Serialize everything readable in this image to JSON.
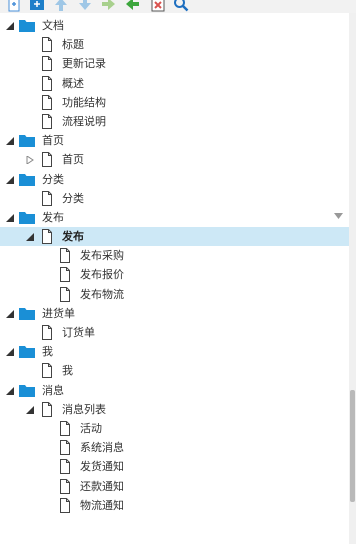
{
  "toolbar": {
    "buttons": [
      {
        "name": "new-file-icon",
        "color": "#4a90d9"
      },
      {
        "name": "new-folder-icon",
        "color": "#1e7fc9"
      },
      {
        "name": "move-up-icon",
        "color": "#9fc7e6"
      },
      {
        "name": "move-down-icon",
        "color": "#9fc7e6"
      },
      {
        "name": "indent-icon",
        "color": "#a8d08d"
      },
      {
        "name": "outdent-icon",
        "color": "#3ca63c"
      },
      {
        "name": "delete-icon",
        "color": "#d9534f"
      },
      {
        "name": "search-icon",
        "color": "#1e6fc0"
      }
    ]
  },
  "tree": {
    "nodes": [
      {
        "label": "文档",
        "type": "folder",
        "level": 0,
        "expander": "expanded"
      },
      {
        "label": "标题",
        "type": "file",
        "level": 1
      },
      {
        "label": "更新记录",
        "type": "file",
        "level": 1
      },
      {
        "label": "概述",
        "type": "file",
        "level": 1
      },
      {
        "label": "功能结构",
        "type": "file",
        "level": 1
      },
      {
        "label": "流程说明",
        "type": "file",
        "level": 1
      },
      {
        "label": "首页",
        "type": "folder",
        "level": 0,
        "expander": "expanded"
      },
      {
        "label": "首页",
        "type": "file",
        "level": 1,
        "expander": "collapsed"
      },
      {
        "label": "分类",
        "type": "folder",
        "level": 0,
        "expander": "expanded"
      },
      {
        "label": "分类",
        "type": "file",
        "level": 1
      },
      {
        "label": "发布",
        "type": "folder",
        "level": 0,
        "expander": "expanded"
      },
      {
        "label": "发布",
        "type": "file",
        "level": 1,
        "expander": "expanded",
        "selected": true,
        "bold": true
      },
      {
        "label": "发布采购",
        "type": "file",
        "level": 2
      },
      {
        "label": "发布报价",
        "type": "file",
        "level": 2
      },
      {
        "label": "发布物流",
        "type": "file",
        "level": 2
      },
      {
        "label": "进货单",
        "type": "folder",
        "level": 0,
        "expander": "expanded"
      },
      {
        "label": "订货单",
        "type": "file",
        "level": 1
      },
      {
        "label": "我",
        "type": "folder",
        "level": 0,
        "expander": "expanded"
      },
      {
        "label": "我",
        "type": "file",
        "level": 1
      },
      {
        "label": "消息",
        "type": "folder",
        "level": 0,
        "expander": "expanded"
      },
      {
        "label": "消息列表",
        "type": "file",
        "level": 1,
        "expander": "expanded"
      },
      {
        "label": "活动",
        "type": "file",
        "level": 2
      },
      {
        "label": "系统消息",
        "type": "file",
        "level": 2
      },
      {
        "label": "发货通知",
        "type": "file",
        "level": 2
      },
      {
        "label": "还款通知",
        "type": "file",
        "level": 2
      },
      {
        "label": "物流通知",
        "type": "file",
        "level": 2
      }
    ]
  },
  "colors": {
    "folder": "#1a8fd6",
    "selection": "#cde8f6",
    "expander": "#333333",
    "collapsed_expander": "#888888"
  }
}
